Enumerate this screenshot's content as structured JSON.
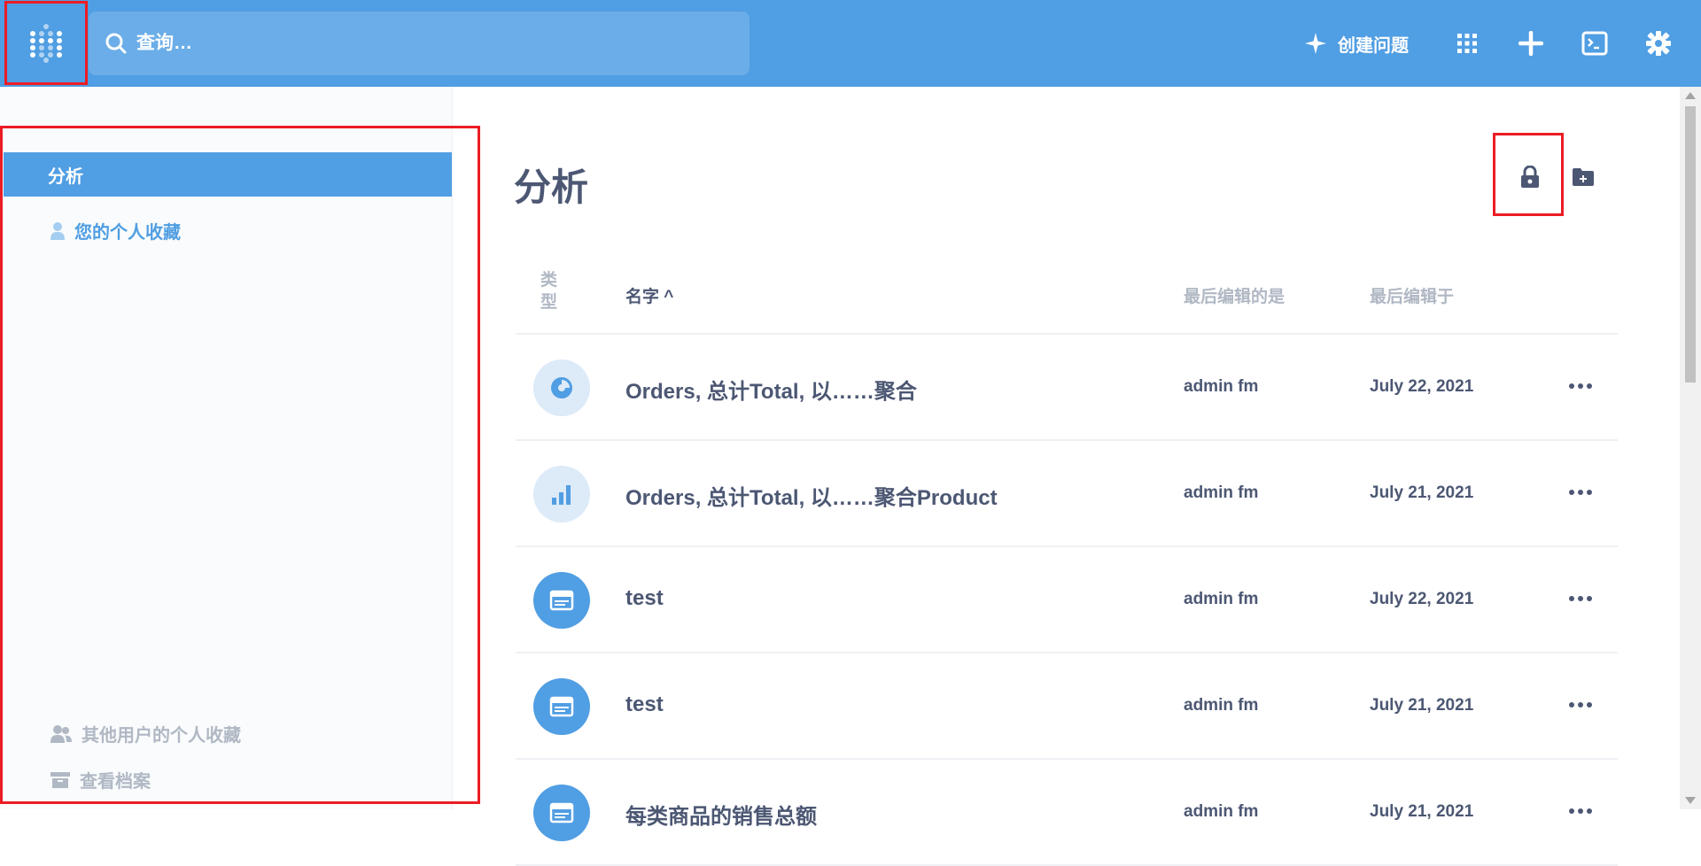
{
  "navbar": {
    "search_placeholder": "查询…",
    "create_question_label": "创建问题",
    "icons": [
      "metabase-logo-icon",
      "search-icon",
      "sparkle-icon",
      "grid-icon",
      "plus-icon",
      "terminal-icon",
      "gear-icon"
    ]
  },
  "sidebar": {
    "active_label": "分析",
    "personal_label": "您的个人收藏",
    "others_label": "其他用户的个人收藏",
    "archive_label": "查看档案"
  },
  "main": {
    "title": "分析",
    "columns": {
      "type": "类型",
      "name": "名字",
      "name_sort": "^",
      "last_editor": "最后编辑的是",
      "last_edited": "最后编辑于"
    },
    "rows": [
      {
        "type": "pie",
        "name": "Orders, 总计Total, 以……聚合",
        "editor": "admin fm",
        "date": "July 22, 2021"
      },
      {
        "type": "bar",
        "name": "Orders, 总计Total, 以……聚合Product",
        "editor": "admin fm",
        "date": "July 21, 2021"
      },
      {
        "type": "table",
        "name": "test",
        "editor": "admin fm",
        "date": "July 22, 2021"
      },
      {
        "type": "table",
        "name": "test",
        "editor": "admin fm",
        "date": "July 21, 2021"
      },
      {
        "type": "table",
        "name": "每类商品的销售总额",
        "editor": "admin fm",
        "date": "July 21, 2021"
      }
    ]
  },
  "colors": {
    "brand": "#509ee3",
    "text": "#4c5773",
    "muted": "#b0b8c4",
    "highlight_frame": "#ec1c24"
  }
}
